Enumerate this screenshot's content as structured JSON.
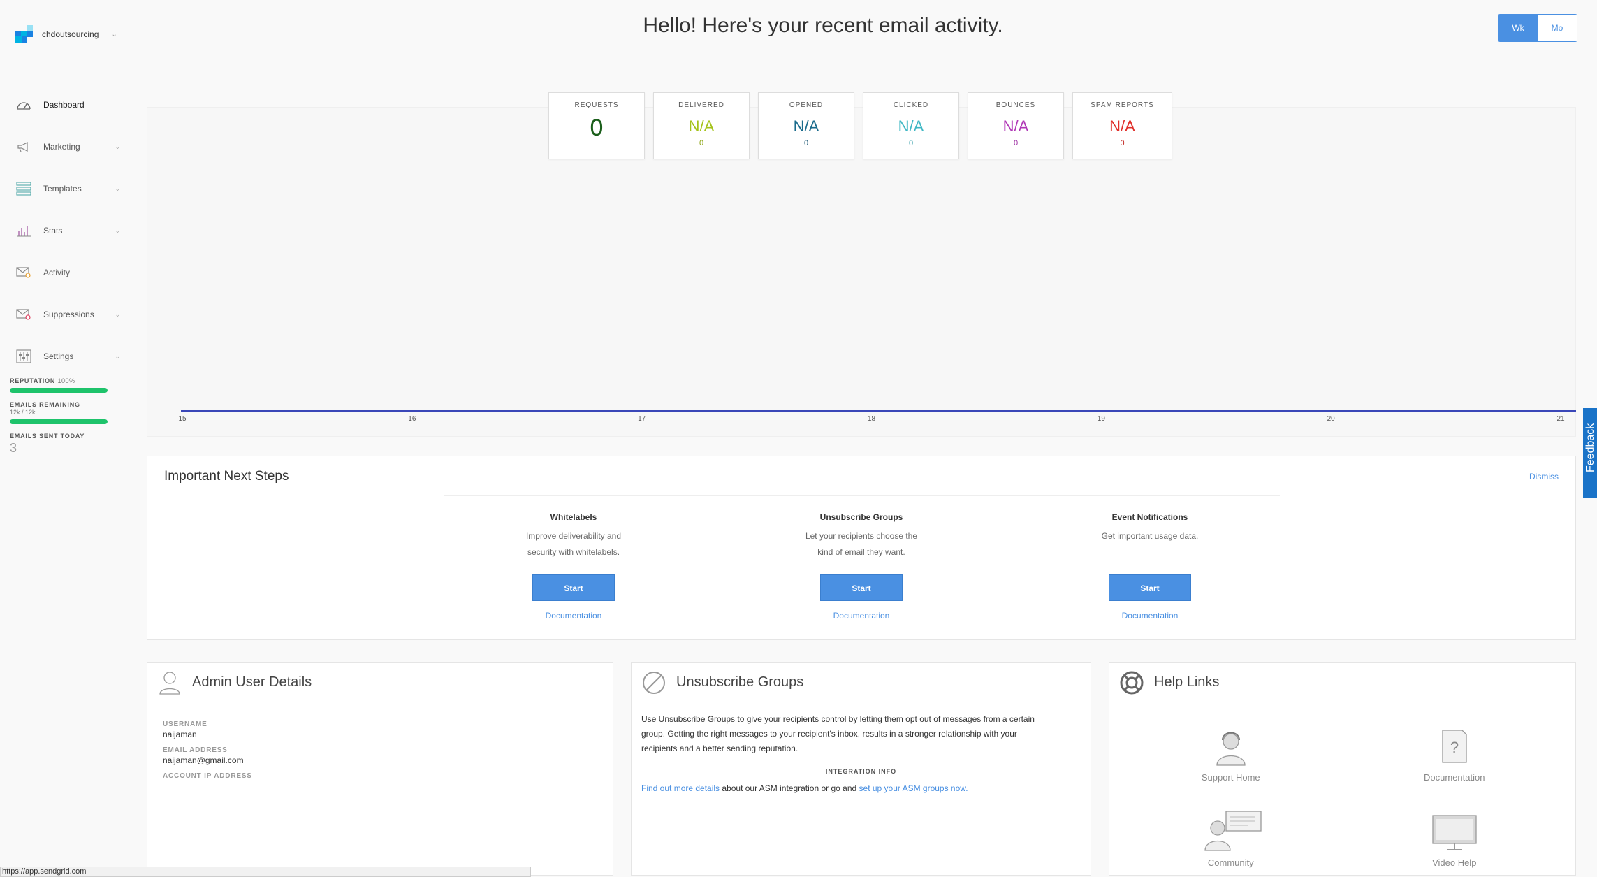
{
  "account": {
    "name": "chdoutsourcing"
  },
  "header": {
    "title": "Hello! Here's your recent email activity.",
    "toggle": [
      "Wk",
      "Mo"
    ]
  },
  "sidebar": {
    "items": [
      {
        "label": "Dashboard",
        "icon": "speedometer-icon",
        "expandable": false
      },
      {
        "label": "Marketing",
        "icon": "megaphone-icon",
        "expandable": true
      },
      {
        "label": "Templates",
        "icon": "template-icon",
        "expandable": true
      },
      {
        "label": "Stats",
        "icon": "bar-chart-icon",
        "expandable": true
      },
      {
        "label": "Activity",
        "icon": "envelope-search-icon",
        "expandable": false
      },
      {
        "label": "Suppressions",
        "icon": "envelope-block-icon",
        "expandable": true
      },
      {
        "label": "Settings",
        "icon": "sliders-icon",
        "expandable": true
      }
    ],
    "reputation": {
      "label": "REPUTATION",
      "value": "100%",
      "fraction": 1.0
    },
    "emails_remaining": {
      "label": "EMAILS REMAINING",
      "value": "12k / 12k",
      "fraction": 1.0
    },
    "emails_sent_today": {
      "label": "EMAILS SENT TODAY",
      "value": "3"
    }
  },
  "stats": [
    {
      "label": "REQUESTS",
      "value": "0",
      "count": "",
      "color": "#1a5e1a"
    },
    {
      "label": "DELIVERED",
      "value": "N/A",
      "count": "0",
      "color": "#a4c21a"
    },
    {
      "label": "OPENED",
      "value": "N/A",
      "count": "0",
      "color": "#1a6b8c"
    },
    {
      "label": "CLICKED",
      "value": "N/A",
      "count": "0",
      "color": "#3fb7c4"
    },
    {
      "label": "BOUNCES",
      "value": "N/A",
      "count": "0",
      "color": "#b036b6"
    },
    {
      "label": "SPAM REPORTS",
      "value": "N/A",
      "count": "0",
      "color": "#e0302b"
    }
  ],
  "chart_data": {
    "type": "line",
    "x": [
      "15",
      "16",
      "17",
      "18",
      "19",
      "20",
      "21"
    ],
    "series": [
      {
        "values": [
          0,
          0,
          0,
          0,
          0,
          0,
          0
        ]
      }
    ],
    "line_color": "#3a47b8"
  },
  "next_steps": {
    "title": "Important Next Steps",
    "dismiss": "Dismiss",
    "items": [
      {
        "title": "Whitelabels",
        "desc1": "Improve deliverability and",
        "desc2": "security with whitelabels.",
        "button": "Start",
        "link": "Documentation"
      },
      {
        "title": "Unsubscribe Groups",
        "desc1": "Let your recipients choose the",
        "desc2": "kind of email they want.",
        "button": "Start",
        "link": "Documentation"
      },
      {
        "title": "Event Notifications",
        "desc1": "Get important usage data.",
        "desc2": "",
        "button": "Start",
        "link": "Documentation"
      }
    ]
  },
  "admin": {
    "title": "Admin User Details",
    "username_label": "USERNAME",
    "username": "naijaman",
    "email_label": "EMAIL ADDRESS",
    "email": "naijaman@gmail.com",
    "ip_label": "ACCOUNT IP ADDRESS"
  },
  "unsubscribe": {
    "title": "Unsubscribe Groups",
    "line1": "Use Unsubscribe Groups to give your recipients control by letting them opt out of messages from a certain",
    "line2": "group. Getting the right messages to your recipient's inbox, results in a stronger relationship with your",
    "line3": "recipients and a better sending reputation.",
    "integration_label": "INTEGRATION INFO",
    "link1": "Find out more details",
    "mid": " about our ASM integration or go and ",
    "link2": "set up your ASM groups now."
  },
  "help": {
    "title": "Help Links",
    "items": [
      "Support Home",
      "Documentation",
      "Community",
      "Video Help"
    ]
  },
  "feedback": "Feedback",
  "status_url": "https://app.sendgrid.com"
}
